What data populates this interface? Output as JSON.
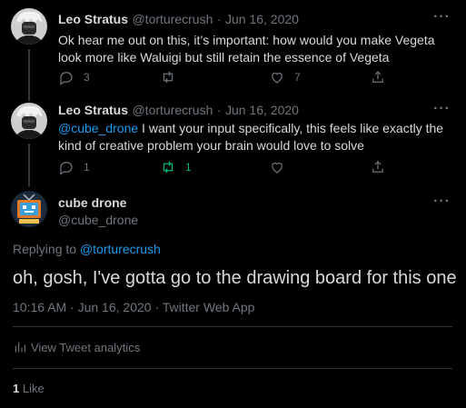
{
  "tweets": [
    {
      "author_name": "Leo Stratus",
      "author_handle": "@torturecrush",
      "separator": "·",
      "date": "Jun 16, 2020",
      "text": "Ok hear me out on this, it’s important: how would you make Vegeta look more like Waluigi but still retain the essence of Vegeta",
      "reply_count": "3",
      "retweet_count": "",
      "like_count": "7"
    },
    {
      "author_name": "Leo Stratus",
      "author_handle": "@torturecrush",
      "separator": "·",
      "date": "Jun 16, 2020",
      "mention": "@cube_drone",
      "text": " I want your input specifically, this feels like exactly the kind of creative problem your brain would love to solve",
      "reply_count": "1",
      "retweet_count": "1",
      "like_count": ""
    }
  ],
  "main": {
    "author_name": "cube drone",
    "author_handle": "@cube_drone",
    "replying_prefix": "Replying to ",
    "replying_handle": "@torturecrush",
    "text": "oh, gosh, I've gotta go to the drawing board for this one",
    "timestamp": "10:16 AM · Jun 16, 2020 · Twitter Web App",
    "analytics_label": "View Tweet analytics",
    "likes_count": "1",
    "likes_label": " Like"
  },
  "more_glyph": "···",
  "colors": {
    "link": "#1d9bf0",
    "retweet_active": "#00ba7c",
    "muted": "#6e767d",
    "background": "#000000"
  },
  "icons": [
    "reply-icon",
    "retweet-icon",
    "like-icon",
    "share-icon",
    "analytics-icon",
    "more-icon"
  ]
}
